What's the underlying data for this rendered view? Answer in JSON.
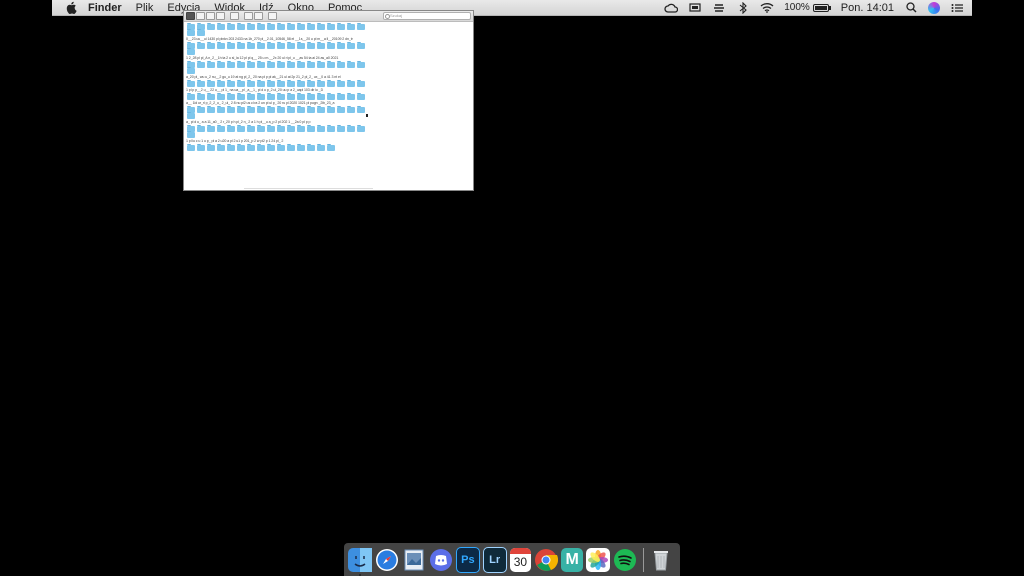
{
  "menubar": {
    "app_name": "Finder",
    "items": [
      "Plik",
      "Edycja",
      "Widok",
      "Idź",
      "Okno",
      "Pomoc"
    ],
    "battery_percent": "100%",
    "battery_level": 1.0,
    "clock": "Pon. 14:01"
  },
  "window": {
    "search_placeholder": "Szukaj",
    "folder_rows": [
      20,
      19,
      19,
      18,
      18,
      19,
      19,
      15
    ],
    "label_rows": [
      "0__23 uu__ul 1430 pl plnkn 203 2433 na 1b_270 pl__2.01_10546_58 el __1s__20 u pl m__a ll__20109 2 dn_tr",
      "1 2_28 pl pl_A n_2__1h ta 2 u sl_la 12 pl pl q__ 25 u m.__2x 20 ul ri pl_u __as 54 ta ai 24 as_a0 2021",
      "a_20 pl_ wu u_2 nu__2 gu_u 19 at ng pl_2_ 20 na pl p pl ak__21 ul at 2p 21_2 pl_2_ ux__0 a 41 3 nt el",
      "1 pl p p__2 u__ 22 u__ pl 1_ na ua__pl _a__1_ pl d u p_2 ul_20 uu p a 2_uapl 103 dir lo _D ",
      "a__ 1ld ur_rl p_2_2_u_ 2_ul_ 2 8 nu pl2 us cl ra 2 un pl ul p_ 20 ru pl 2020 1021 pl pugn _2lb_23_a",
      "a_ pl d u_ a a 11_a0 _ 2 r_20 p h pl_2 n_ 2 a 1 h pl__u a_p 2 pl 202 1 __2a 0 pl p p",
      "1 pl lu c u 1 u p_ pl a 2 u20 a pl 2 u1 p 201_p 2 w pl2 p 1 24 pl_ 2"
    ]
  },
  "dock": {
    "apps": [
      {
        "name": "finder",
        "label": "",
        "color": "#3d8fe0",
        "running": true
      },
      {
        "name": "safari",
        "label": "",
        "color": "#2a7de1",
        "running": false
      },
      {
        "name": "preview",
        "label": "",
        "color": "#6b8fb8",
        "running": false
      },
      {
        "name": "discord",
        "label": "",
        "color": "#5b6ee8",
        "running": false
      },
      {
        "name": "photoshop",
        "label": "Ps",
        "color": "#0c2a47",
        "running": false
      },
      {
        "name": "lightroom",
        "label": "Lr",
        "color": "#0f2a3a",
        "running": false
      },
      {
        "name": "calendar",
        "label": "30",
        "color": "#ffffff",
        "running": false
      },
      {
        "name": "chrome",
        "label": "",
        "color": "#ffffff",
        "running": false
      },
      {
        "name": "medium",
        "label": "M",
        "color": "#38b2a6",
        "running": false
      },
      {
        "name": "photos",
        "label": "",
        "color": "#ffffff",
        "running": false
      },
      {
        "name": "spotify",
        "label": "",
        "color": "#1db954",
        "running": false
      },
      {
        "name": "trash",
        "label": "",
        "color": "#cfd3d6",
        "running": false
      }
    ]
  }
}
